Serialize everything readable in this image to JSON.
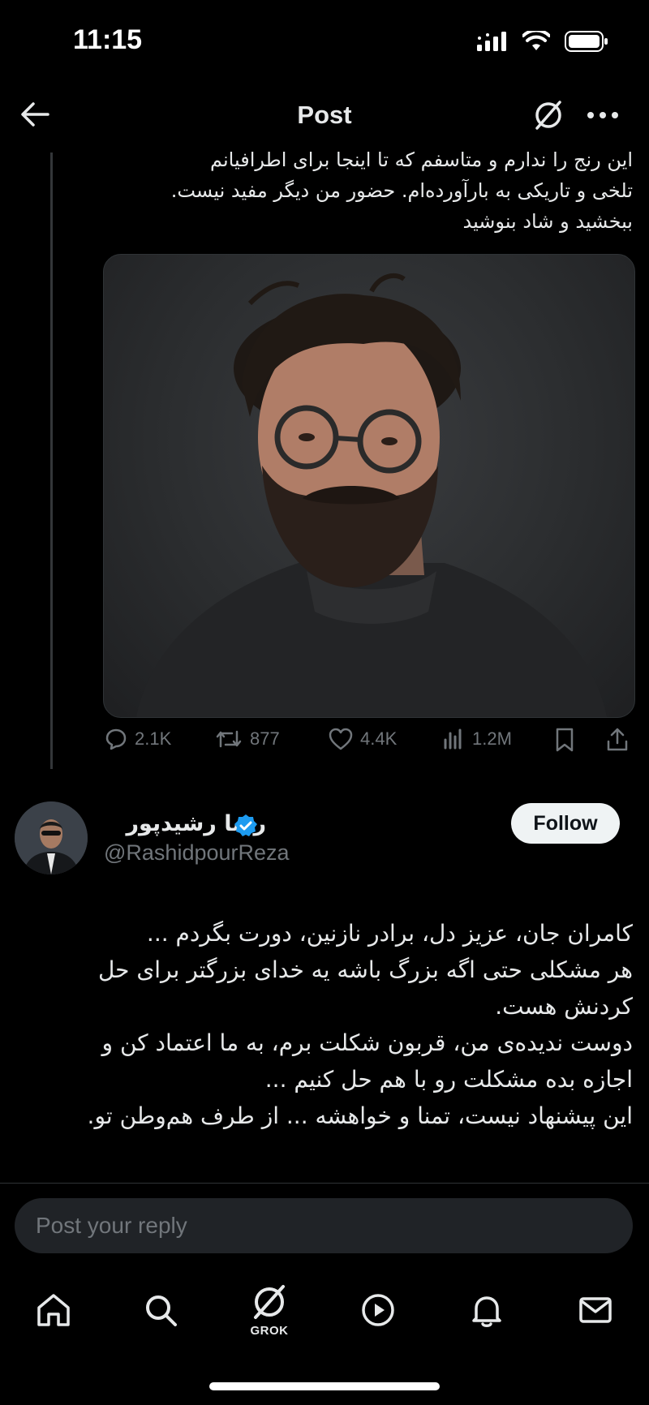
{
  "status_bar": {
    "time": "11:15"
  },
  "header": {
    "title": "Post"
  },
  "quoted_post": {
    "text_lines": [
      "این رنج را ندارم و متاسفم که تا اینجا برای اطرافیانم",
      "تلخی و تاریکی به بارآورده‌ام. حضور من دیگر مفید نیست.",
      "ببخشید و شاد بنوشید"
    ],
    "media": {
      "alt": "video-thumbnail"
    },
    "stats": {
      "replies": "2.1K",
      "reposts": "877",
      "likes": "4.4K",
      "views": "1.2M"
    }
  },
  "reply_post": {
    "author_name": "رضا رشیدپور",
    "handle": "@RashidpourReza",
    "follow_label": "Follow",
    "text_lines": [
      "کامران جان، عزیز دل، برادر نازنین، دورت بگردم ...",
      "هر مشکلی حتی اگه بزرگ باشه یه خدای بزرگتر برای حل",
      "کردنش هست.",
      "دوست ندیده‌ی من، قربون شکلت برم، به ما اعتماد کن و",
      "اجازه بده مشکلت رو با هم حل کنیم ...",
      "این پیشنهاد نیست، تمنا و خواهشه ... از طرف هم‌وطن تو."
    ]
  },
  "composer": {
    "placeholder": "Post your reply"
  },
  "tabbar": {
    "grok_label": "GROK"
  },
  "colors": {
    "background": "#000000",
    "text": "#e7e9ea",
    "muted": "#71767b",
    "verified": "#1d9bf0"
  }
}
